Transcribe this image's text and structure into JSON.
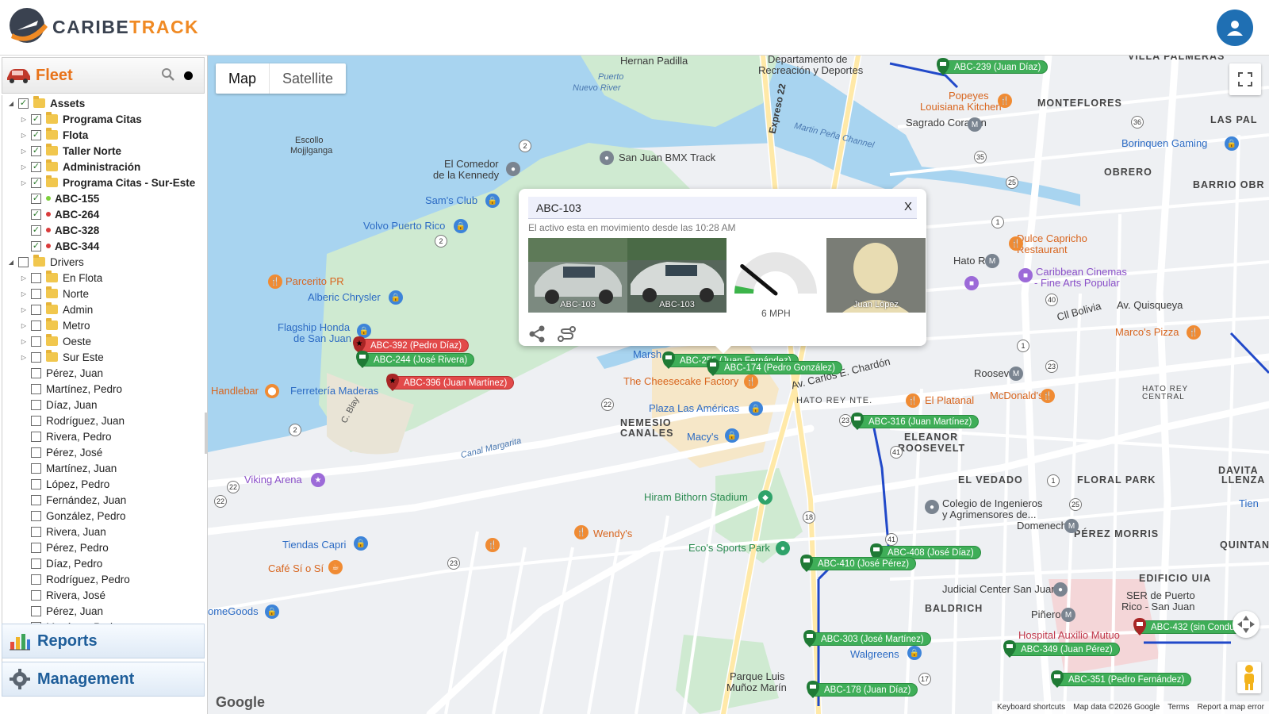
{
  "app": {
    "brand_part1": "CARIBE",
    "brand_part2": "TRACK"
  },
  "sidebar": {
    "fleet_title": "Fleet",
    "tree": [
      {
        "label": "Assets",
        "level": 0,
        "expand": "open",
        "checked": true,
        "folder": true,
        "bold": true
      },
      {
        "label": "Programa Citas",
        "level": 1,
        "expand": "closed",
        "checked": true,
        "folder": true,
        "bold": true
      },
      {
        "label": "Flota",
        "level": 1,
        "expand": "closed",
        "checked": true,
        "folder": true,
        "bold": true
      },
      {
        "label": "Taller Norte",
        "level": 1,
        "expand": "closed",
        "checked": true,
        "folder": true,
        "bold": true
      },
      {
        "label": "Administración",
        "level": 1,
        "expand": "closed",
        "checked": true,
        "folder": true,
        "bold": true
      },
      {
        "label": "Programa Citas - Sur-Este",
        "level": 1,
        "expand": "closed",
        "checked": true,
        "folder": true,
        "bold": true
      },
      {
        "label": "ABC-155",
        "level": 1,
        "expand": "none",
        "checked": true,
        "folder": false,
        "bold": true,
        "status_color": "#7dcf3a"
      },
      {
        "label": "ABC-264",
        "level": 1,
        "expand": "none",
        "checked": true,
        "folder": false,
        "bold": true,
        "status_color": "#d93b3b"
      },
      {
        "label": "ABC-328",
        "level": 1,
        "expand": "none",
        "checked": true,
        "folder": false,
        "bold": true,
        "status_color": "#d93b3b"
      },
      {
        "label": "ABC-344",
        "level": 1,
        "expand": "none",
        "checked": true,
        "folder": false,
        "bold": true,
        "status_color": "#d93b3b"
      },
      {
        "label": "Drivers",
        "level": 0,
        "expand": "open",
        "checked": false,
        "folder": true,
        "bold": false
      },
      {
        "label": "En Flota",
        "level": 1,
        "expand": "closed",
        "checked": false,
        "folder": true,
        "bold": false
      },
      {
        "label": "Norte",
        "level": 1,
        "expand": "closed",
        "checked": false,
        "folder": true,
        "bold": false
      },
      {
        "label": "Admin",
        "level": 1,
        "expand": "closed",
        "checked": false,
        "folder": true,
        "bold": false
      },
      {
        "label": "Metro",
        "level": 1,
        "expand": "closed",
        "checked": false,
        "folder": true,
        "bold": false
      },
      {
        "label": "Oeste",
        "level": 1,
        "expand": "closed",
        "checked": false,
        "folder": true,
        "bold": false
      },
      {
        "label": "Sur Este",
        "level": 1,
        "expand": "closed",
        "checked": false,
        "folder": true,
        "bold": false
      },
      {
        "label": "Pérez, Juan",
        "level": 1,
        "expand": "none",
        "checked": false,
        "folder": false,
        "bold": false
      },
      {
        "label": "Martínez, Pedro",
        "level": 1,
        "expand": "none",
        "checked": false,
        "folder": false,
        "bold": false
      },
      {
        "label": "Díaz, Juan",
        "level": 1,
        "expand": "none",
        "checked": false,
        "folder": false,
        "bold": false
      },
      {
        "label": "Rodríguez, Juan",
        "level": 1,
        "expand": "none",
        "checked": false,
        "folder": false,
        "bold": false
      },
      {
        "label": "Rivera, Pedro",
        "level": 1,
        "expand": "none",
        "checked": false,
        "folder": false,
        "bold": false
      },
      {
        "label": "Pérez, José",
        "level": 1,
        "expand": "none",
        "checked": false,
        "folder": false,
        "bold": false
      },
      {
        "label": "Martínez, Juan",
        "level": 1,
        "expand": "none",
        "checked": false,
        "folder": false,
        "bold": false
      },
      {
        "label": "López, Pedro",
        "level": 1,
        "expand": "none",
        "checked": false,
        "folder": false,
        "bold": false
      },
      {
        "label": "Fernández, Juan",
        "level": 1,
        "expand": "none",
        "checked": false,
        "folder": false,
        "bold": false
      },
      {
        "label": "González, Pedro",
        "level": 1,
        "expand": "none",
        "checked": false,
        "folder": false,
        "bold": false
      },
      {
        "label": "Rivera, Juan",
        "level": 1,
        "expand": "none",
        "checked": false,
        "folder": false,
        "bold": false
      },
      {
        "label": "Pérez, Pedro",
        "level": 1,
        "expand": "none",
        "checked": false,
        "folder": false,
        "bold": false
      },
      {
        "label": "Díaz, Pedro",
        "level": 1,
        "expand": "none",
        "checked": false,
        "folder": false,
        "bold": false
      },
      {
        "label": "Rodríguez, Pedro",
        "level": 1,
        "expand": "none",
        "checked": false,
        "folder": false,
        "bold": false
      },
      {
        "label": "Rivera, José",
        "level": 1,
        "expand": "none",
        "checked": false,
        "folder": false,
        "bold": false
      },
      {
        "label": "Pérez, Juan",
        "level": 1,
        "expand": "none",
        "checked": false,
        "folder": false,
        "bold": false
      },
      {
        "label": "Martínez, Pedro",
        "level": 1,
        "expand": "none",
        "checked": false,
        "folder": false,
        "bold": false
      }
    ],
    "reports_label": "Reports",
    "management_label": "Management"
  },
  "map": {
    "type_map": "Map",
    "type_satellite": "Satellite",
    "google": "Google",
    "attribution": {
      "shortcuts": "Keyboard shortcuts",
      "data": "Map data ©2026 Google",
      "terms": "Terms",
      "report": "Report a map error"
    },
    "labels": {
      "hernan": "Hernan Padilla",
      "departamento": "Departamento de",
      "recreacion": "Recreación y Deportes",
      "villa": "VILLA PALMERAS",
      "puerto": "Puerto",
      "nuevo": "Nuevo River",
      "escollo": "Escollo",
      "mojilganga": "Mojjlganga",
      "comedor": "El Comedor",
      "kennedy": "de la Kennedy",
      "bmx": "San Juan BMX Track",
      "sams": "Sam's Club",
      "volvo": "Volvo Puerto Rico",
      "parcerito": "Parcerito PR",
      "alberic": "Alberic Chrysler",
      "flagship": "Flagship Honda",
      "dejuan": "de San Juan",
      "handlebar": "Handlebar",
      "ferreteria": "Ferretería Maderas",
      "cheesecake": "The Cheesecake Factory",
      "plaza": "Plaza Las Américas",
      "macys": "Macy's",
      "nemesio": "NEMESIO",
      "canales": "CANALES",
      "viking": "Viking Arena",
      "hiram": "Hiram Bithorn Stadium",
      "wendys": "Wendy's",
      "tiendas": "Tiendas Capri",
      "cafe": "Café Sí o Sí",
      "ecos": "Eco's Sports Park",
      "homegoods": "omeGoods",
      "walgreens": "Walgreens",
      "parque": "Parque Luis",
      "munoz": "Muñoz Marín",
      "popeyes": "Popeyes",
      "louisiana": "Louisiana Kitchen",
      "sagrado": "Sagrado Corazón",
      "monteflores": "MONTEFLORES",
      "laspal": "LAS PAL",
      "borinquen": "Borinquen Gaming",
      "obrero": "OBRERO",
      "barrio": "BARRIO OBR",
      "dulce": "Dulce Capricho",
      "restaurant": "Restaurant",
      "hatorey": "Hato Rey",
      "caribbean": "Caribbean Cinemas",
      "fine": "- Fine Arts Popular",
      "quisqueya": "Av. Quisqueya",
      "marcos": "Marco's Pizza",
      "bolivia": "Cll Bolivia",
      "roosevelt": "Roosevelt",
      "elplatanal": "El Platanal",
      "mcdonalds": "McDonald's",
      "hatoreynte": "HATO REY NTE.",
      "hatoreycentral": "HATO REY",
      "central": "CENTRAL",
      "eleanor": "ELEANOR",
      "rooseveltarea": "ROOSEVELT",
      "elvedado": "EL VEDADO",
      "floral": "FLORAL PARK",
      "davita": "DAVITA",
      "llenza": "LLENZA",
      "colegio": "Colegio de Ingenieros",
      "agrimensores": "y Agrimensores de...",
      "domenech": "Domenech",
      "perezmorris": "PÉREZ MORRIS",
      "quintana": "QUINTAN",
      "edificio": "EDIFICIO UIA",
      "judicial": "Judicial Center San Juan",
      "baldrich": "BALDRICH",
      "pinero": "Piñero",
      "ser": "SER de Puerto",
      "rico": "Rico - San Juan",
      "auxilio": "Hospital Auxilio Mutuo",
      "marshalls": "Marsh",
      "chardon": "Av. Carlos E. Chardón",
      "canalmargarita": "Canal Margarita",
      "martinpena": "Martin Peña Channel",
      "expreso": "Expreso 22",
      "cgby": "C. Blay",
      "tien": "Tien"
    },
    "vehicles": [
      {
        "label": "ABC-239 (Juan Díaz)",
        "color": "green"
      },
      {
        "label": "ABC-392 (Pedro Díaz)",
        "color": "red"
      },
      {
        "label": "ABC-244 (José Rivera)",
        "color": "green"
      },
      {
        "label": "ABC-396 (Juan Martínez)",
        "color": "red"
      },
      {
        "label": "ABC-255 (Juan Fernández)",
        "color": "green"
      },
      {
        "label": "ABC-174 (Pedro González)",
        "color": "green"
      },
      {
        "label": "ABC-316 (Juan Martínez)",
        "color": "green"
      },
      {
        "label": "ABC-408 (José Díaz)",
        "color": "green"
      },
      {
        "label": "ABC-410 (José Pérez)",
        "color": "green"
      },
      {
        "label": "ABC-303 (José Martínez)",
        "color": "green"
      },
      {
        "label": "ABC-349 (Juan Pérez)",
        "color": "green"
      },
      {
        "label": "ABC-432 (sin Conduc",
        "color": "green"
      },
      {
        "label": "ABC-351 (Pedro Fernández)",
        "color": "green"
      },
      {
        "label": "ABC-178 (Juan Díaz)",
        "color": "green"
      }
    ]
  },
  "popup": {
    "title": "ABC-103",
    "close": "X",
    "status": "El activo esta en movimiento desde las 10:28 AM",
    "photo1_caption": "ABC-103",
    "photo2_caption": "ABC-103",
    "speed": "6 MPH",
    "speed_mph": 6,
    "driver_caption": "Juan López"
  }
}
